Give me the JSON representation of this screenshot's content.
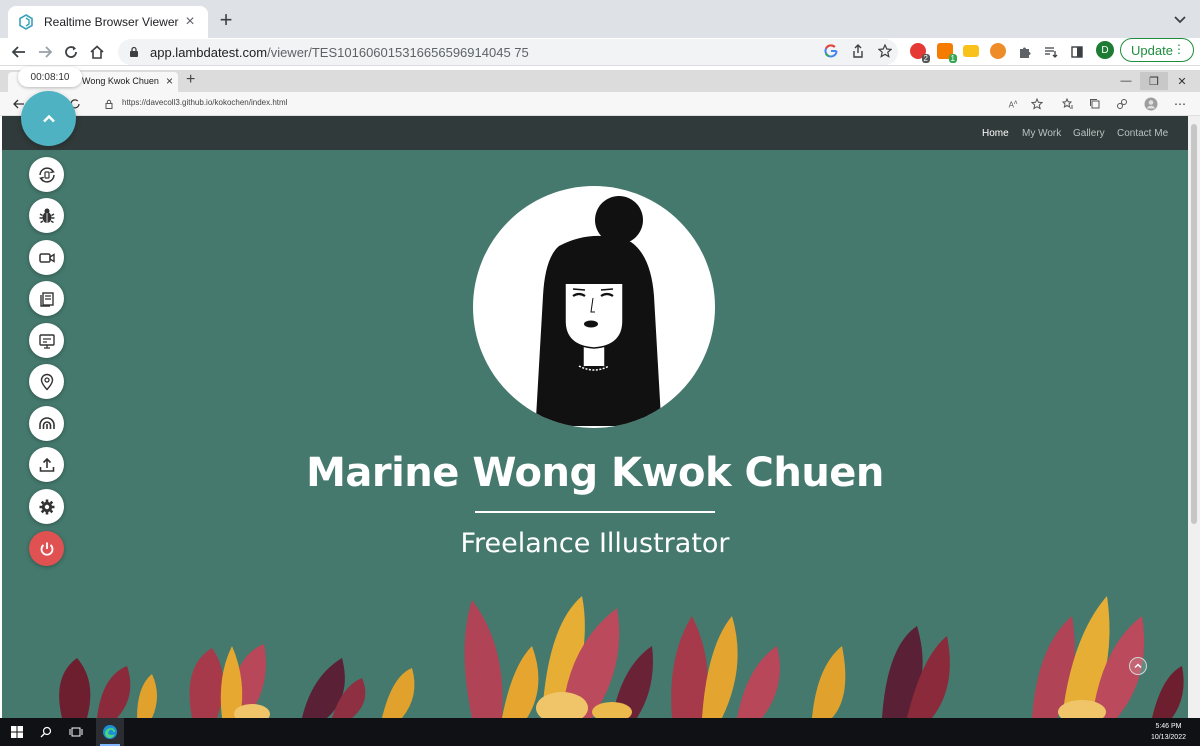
{
  "browser": {
    "tab_title": "Realtime Browser Viewer",
    "url_host": "app.lambdatest.com",
    "url_path": "/viewer/TES101606015316656596914045 75",
    "update_label": "Update",
    "profile_initial": "D",
    "extensions": [
      {
        "name": "adblock-icon",
        "color": "#e53935",
        "badge": "2"
      },
      {
        "name": "extension-orange-icon",
        "color": "#f57c00",
        "badge": "1"
      },
      {
        "name": "extension-yellow-icon",
        "color": "#f9c21a"
      },
      {
        "name": "grammarly-icon",
        "color": "#ef8c2a"
      }
    ]
  },
  "session": {
    "timer": "00:08:10"
  },
  "remote_browser": {
    "tab_title": "Wong Kwok Chuen",
    "url": "https://davecoll3.github.io/kokochen/index.html"
  },
  "site": {
    "nav": [
      {
        "label": "Home",
        "active": true
      },
      {
        "label": "My Work",
        "active": false
      },
      {
        "label": "Gallery",
        "active": false
      },
      {
        "label": "Contact Me",
        "active": false
      }
    ],
    "hero_name": "Marine Wong Kwok Chuen",
    "hero_subtitle": "Freelance Illustrator",
    "background_color": "#45796d",
    "nav_color": "#313a3a"
  },
  "lt_toolbar": {
    "accent": "#4fb2c2",
    "stop_color": "#e05252",
    "buttons": [
      "rotate-icon",
      "bug-icon",
      "video-icon",
      "screenshot-icon",
      "resolution-icon",
      "location-icon",
      "network-throttle-icon",
      "upload-icon",
      "settings-icon",
      "stop-session-icon"
    ]
  },
  "taskbar": {
    "time": "5:46 PM",
    "date": "10/13/2022"
  }
}
